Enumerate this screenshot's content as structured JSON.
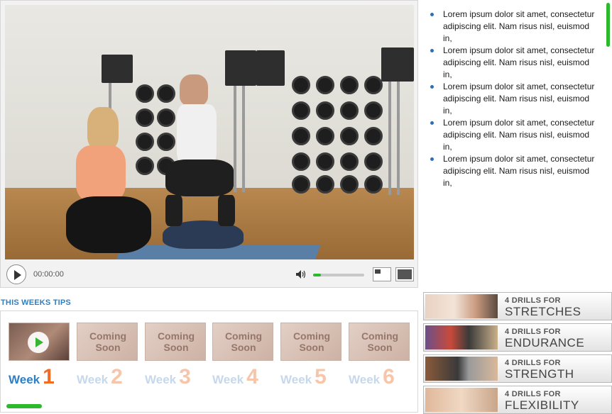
{
  "player": {
    "time": "00:00:00",
    "volume_level": 0.15
  },
  "tips_list": [
    {
      "line1": "Lorem ipsum dolor sit amet, consectetur",
      "line2": "adipiscing elit. Nam risus nisl, euismod in,"
    },
    {
      "line1": "Lorem ipsum dolor sit amet, consectetur",
      "line2": "adipiscing elit. Nam risus nisl, euismod in,"
    },
    {
      "line1": "Lorem ipsum dolor sit amet, consectetur",
      "line2": "adipiscing elit. Nam risus nisl, euismod in,"
    },
    {
      "line1": "Lorem ipsum dolor sit amet, consectetur",
      "line2": "adipiscing elit. Nam risus nisl, euismod in,"
    },
    {
      "line1": "Lorem ipsum dolor sit amet, consectetur",
      "line2": "adipiscing elit. Nam risus nisl, euismod in,"
    }
  ],
  "tips": {
    "title": "THIS WEEKS TIPS",
    "weeks": [
      {
        "word": "Week",
        "num": "1",
        "thumb_text": ""
      },
      {
        "word": "Week",
        "num": "2",
        "thumb_text_1": "Coming",
        "thumb_text_2": "Soon"
      },
      {
        "word": "Week",
        "num": "3",
        "thumb_text_1": "Coming",
        "thumb_text_2": "Soon"
      },
      {
        "word": "Week",
        "num": "4",
        "thumb_text_1": "Coming",
        "thumb_text_2": "Soon"
      },
      {
        "word": "Week",
        "num": "5",
        "thumb_text_1": "Coming",
        "thumb_text_2": "Soon"
      },
      {
        "word": "Week",
        "num": "6",
        "thumb_text_1": "Coming",
        "thumb_text_2": "Soon"
      }
    ]
  },
  "drills": [
    {
      "sub": "4 DRILLS FOR",
      "main": "STRETCHES"
    },
    {
      "sub": "4 DRILLS FOR",
      "main": "ENDURANCE"
    },
    {
      "sub": "4 DRILLS FOR",
      "main": "STRENGTH"
    },
    {
      "sub": "4 DRILLS FOR",
      "main": "FLEXIBILITY"
    }
  ],
  "colors": {
    "accent_blue": "#2f7fc4",
    "accent_orange": "#f36b21",
    "accent_green": "#2db82d"
  }
}
